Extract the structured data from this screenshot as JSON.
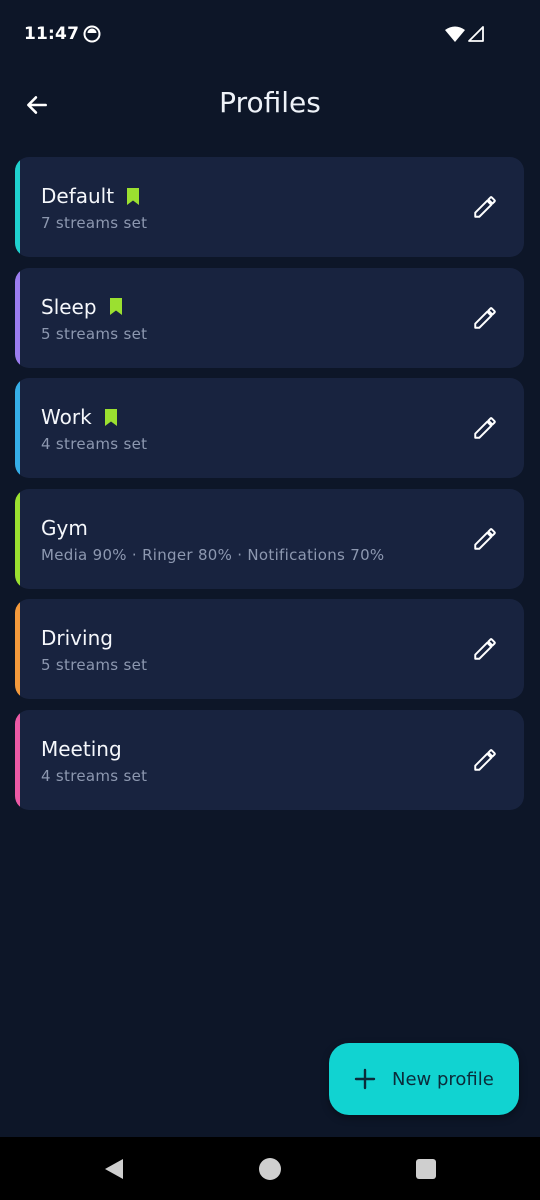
{
  "status_bar": {
    "time": "11:47",
    "icons": [
      "sync-icon",
      "wifi-icon",
      "signal-icon"
    ]
  },
  "app_bar": {
    "title": "Profiles",
    "back_icon": "arrow-left-icon"
  },
  "profiles": [
    {
      "name": "Default",
      "subtitle": "7 streams set",
      "bookmarked": true,
      "accent": "#1fd1cf"
    },
    {
      "name": "Sleep",
      "subtitle": "5 streams set",
      "bookmarked": true,
      "accent": "#9b7df0"
    },
    {
      "name": "Work",
      "subtitle": "4 streams set",
      "bookmarked": true,
      "accent": "#35aee8"
    },
    {
      "name": "Gym",
      "subtitle": "Media 90% · Ringer 80% · Notifications 70%",
      "bookmarked": false,
      "accent": "#9be030"
    },
    {
      "name": "Driving",
      "subtitle": "5 streams set",
      "bookmarked": false,
      "accent": "#f49a3c"
    },
    {
      "name": "Meeting",
      "subtitle": "4 streams set",
      "bookmarked": false,
      "accent": "#ec5aa6"
    }
  ],
  "fab": {
    "label": "New profile",
    "icon": "plus-icon"
  },
  "colors": {
    "background": "#0d1628",
    "card": "#18233f",
    "bookmark": "#9be030",
    "fab": "#11d3d1"
  },
  "nav_bar": {
    "icons": [
      "nav-back-icon",
      "nav-home-icon",
      "nav-recents-icon"
    ]
  }
}
